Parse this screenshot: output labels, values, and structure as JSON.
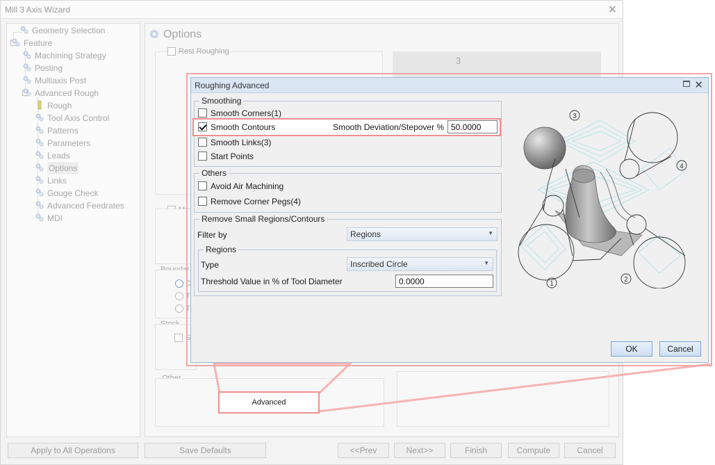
{
  "wizard": {
    "title": "Mill 3 Axis Wizard",
    "tree": [
      {
        "label": "Geometry Selection",
        "level": 1
      },
      {
        "label": "Feature",
        "level": 0
      },
      {
        "label": "Machining Strategy",
        "level": 1
      },
      {
        "label": "Posting",
        "level": 1
      },
      {
        "label": "Multiaxis Post",
        "level": 1
      },
      {
        "label": "Advanced Rough",
        "level": 1
      },
      {
        "label": "Rough",
        "level": 2
      },
      {
        "label": "Tool Axis Control",
        "level": 2
      },
      {
        "label": "Patterns",
        "level": 2
      },
      {
        "label": "Parameters",
        "level": 2
      },
      {
        "label": "Leads",
        "level": 2
      },
      {
        "label": "Options",
        "level": 2,
        "selected": true
      },
      {
        "label": "Links",
        "level": 2
      },
      {
        "label": "Gouge Check",
        "level": 2
      },
      {
        "label": "Advanced Feedrates",
        "level": 2
      },
      {
        "label": "MDI",
        "level": 2
      }
    ],
    "options_title": "Options",
    "rest_roughing": "Rest Roughing",
    "ghost_ma": "Ma",
    "ghost_boundary": "Boundar",
    "ghost_radio_1": "C",
    "ghost_radio_2": "T",
    "ghost_radio_3": "T",
    "ghost_stock": "Stock",
    "ghost_s": "S",
    "ghost_other": "Other",
    "advanced_button": "Advanced",
    "bottom_buttons": {
      "apply_all": "Apply to All Operations",
      "save_defaults": "Save Defaults",
      "prev": "<<Prev",
      "next": "Next>>",
      "finish": "Finish",
      "compute": "Compute",
      "cancel": "Cancel"
    },
    "callout_3": "3"
  },
  "dialog": {
    "title": "Roughing Advanced",
    "smoothing": {
      "legend": "Smoothing",
      "smooth_corners": "Smooth Corners(1)",
      "smooth_contours": "Smooth Contours",
      "smooth_deviation_label": "Smooth Deviation/Stepover %",
      "smooth_deviation_value": "50.0000",
      "smooth_links": "Smooth Links(3)",
      "start_points": "Start Points"
    },
    "others": {
      "legend": "Others",
      "avoid_air": "Avoid Air Machining",
      "remove_corner_pegs": "Remove Corner Pegs(4)"
    },
    "remove_small": {
      "legend": "Remove Small Regions/Contours",
      "filter_by_label": "Filter by",
      "filter_by_value": "Regions",
      "regions_legend": "Regions",
      "type_label": "Type",
      "type_value": "Inscribed Circle",
      "threshold_label": "Threshold Value in % of Tool Diameter",
      "threshold_value": "0.0000"
    },
    "ok": "OK",
    "cancel": "Cancel",
    "illustration_labels": [
      "3",
      "4",
      "1",
      "2"
    ]
  }
}
